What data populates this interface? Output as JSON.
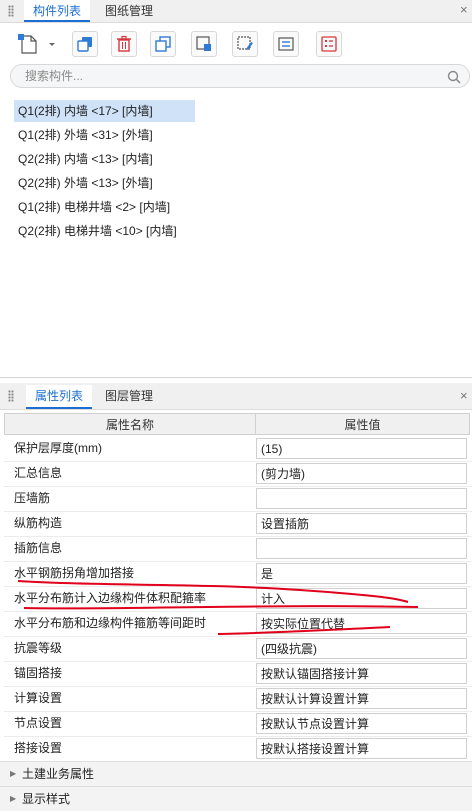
{
  "top_panel": {
    "tabs": [
      {
        "label": "构件列表"
      },
      {
        "label": "图纸管理"
      }
    ],
    "search": {
      "placeholder": "搜索构件..."
    },
    "components": [
      {
        "label": "Q1(2排) 内墙 <17> [内墙]"
      },
      {
        "label": "Q1(2排) 外墙 <31> [外墙]"
      },
      {
        "label": "Q2(2排) 内墙 <13> [内墙]"
      },
      {
        "label": "Q2(2排) 外墙 <13> [外墙]"
      },
      {
        "label": "Q1(2排) 电梯井墙 <2> [内墙]"
      },
      {
        "label": "Q2(2排) 电梯井墙 <10> [内墙]"
      }
    ],
    "close_glyph": "×"
  },
  "property_panel": {
    "tabs": [
      {
        "label": "属性列表"
      },
      {
        "label": "图层管理"
      }
    ],
    "columns": {
      "name": "属性名称",
      "value": "属性值"
    },
    "rows": [
      {
        "name": "保护层厚度(mm)",
        "value": "(15)"
      },
      {
        "name": "汇总信息",
        "value": "(剪力墙)"
      },
      {
        "name": "压墙筋",
        "value": ""
      },
      {
        "name": "纵筋构造",
        "value": "设置插筋"
      },
      {
        "name": "插筋信息",
        "value": ""
      },
      {
        "name": "水平钢筋拐角增加搭接",
        "value": "是"
      },
      {
        "name": "水平分布筋计入边缘构件体积配箍率",
        "value": "计入"
      },
      {
        "name": "水平分布筋和边缘构件箍筋等间距时",
        "value": "按实际位置代替"
      },
      {
        "name": "抗震等级",
        "value": "(四级抗震)"
      },
      {
        "name": "锚固搭接",
        "value": "按默认锚固搭接计算"
      },
      {
        "name": "计算设置",
        "value": "按默认计算设置计算"
      },
      {
        "name": "节点设置",
        "value": "按默认节点设置计算"
      },
      {
        "name": "搭接设置",
        "value": "按默认搭接设置计算"
      }
    ],
    "sections": [
      {
        "label": "土建业务属性"
      },
      {
        "label": "显示样式"
      }
    ],
    "close_glyph": "×"
  },
  "colors": {
    "accent": "#1c6fd1",
    "selection": "#cfe2f7",
    "annotation": "#e0001b"
  }
}
